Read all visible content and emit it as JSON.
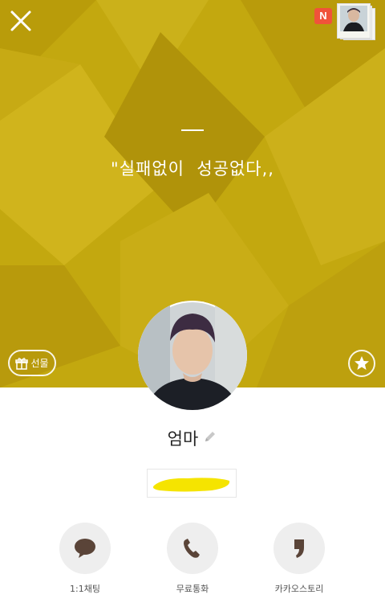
{
  "profile": {
    "status_message": "\"실패없이  성공없다,,",
    "name": "엄마",
    "phone_number_redacted": ""
  },
  "header": {
    "news_badge": "N"
  },
  "buttons": {
    "gift_label": "선물"
  },
  "actions": [
    {
      "label": "1:1채팅",
      "icon": "speech-bubble-icon"
    },
    {
      "label": "무료통화",
      "icon": "phone-icon"
    },
    {
      "label": "카카오스토리",
      "icon": "quote-mark-icon"
    }
  ],
  "colors": {
    "cover_background": "#c3a80f",
    "badge": "#f0533a",
    "icon_brown": "#5a4438",
    "highlight_yellow": "#f5e400"
  }
}
